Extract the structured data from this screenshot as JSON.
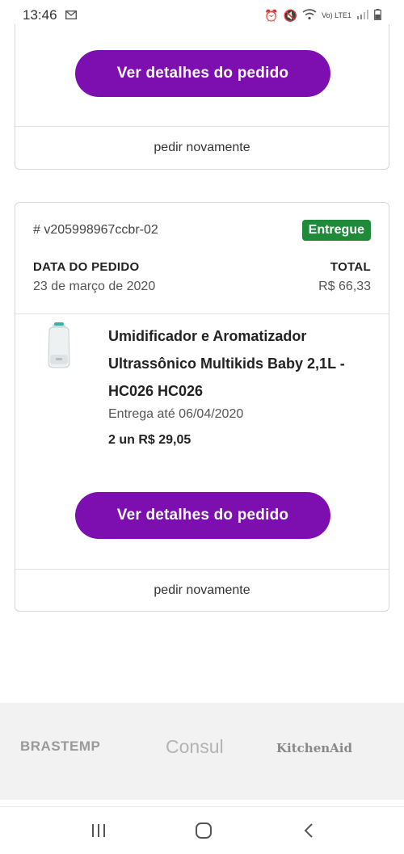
{
  "status": {
    "time": "13:46",
    "left_icon": "gmail-icon",
    "right_text": "Vo) LTE1"
  },
  "card_prev": {
    "details_button": "Ver detalhes do pedido",
    "reorder_link": "pedir novamente"
  },
  "order": {
    "id": "# v205998967ccbr-02",
    "status_badge": "Entregue",
    "status_color": "#1e8a3a",
    "date_label": "DATA DO PEDIDO",
    "date_value": "23 de março de 2020",
    "total_label": "TOTAL",
    "total_value": "R$ 66,33",
    "product": {
      "name": "Umidificador e Aromatizador Ultrassônico Multikids Baby 2,1L - HC026 HC026",
      "delivery": "Entrega até 06/04/2020",
      "qty_price": "2 un  R$ 29,05"
    },
    "details_button": "Ver detalhes do pedido",
    "reorder_link": "pedir novamente"
  },
  "footer": {
    "brands": [
      "BRASTEMP",
      "Consul",
      "KitchenAid"
    ]
  },
  "accent_color": "#7d0fb0"
}
